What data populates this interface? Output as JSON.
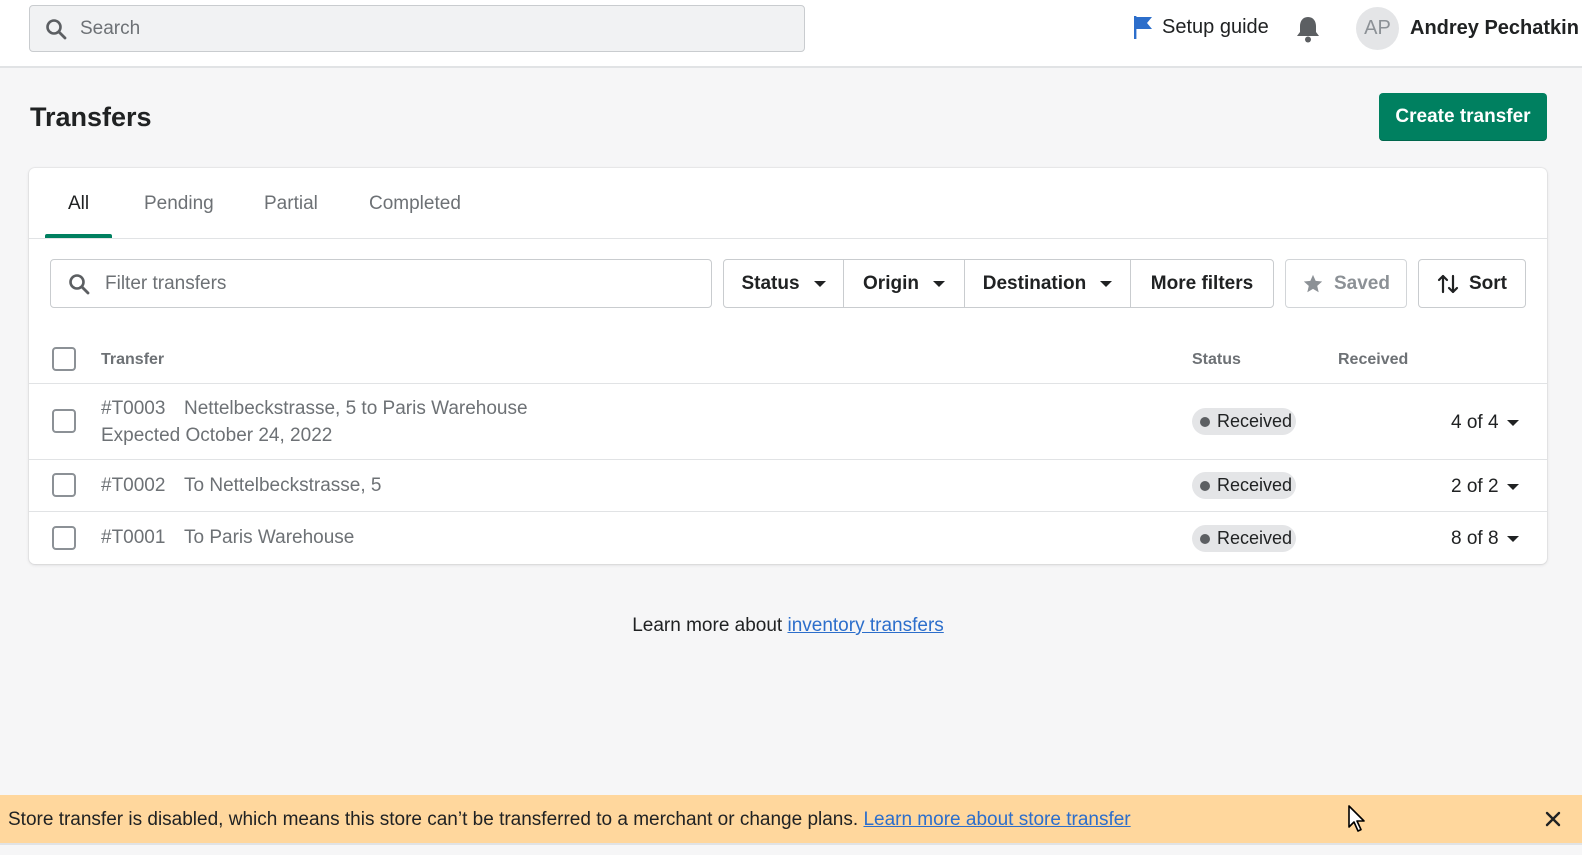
{
  "topbar": {
    "search_placeholder": "Search",
    "setup_guide": "Setup guide",
    "avatar_initials": "AP",
    "user_name": "Andrey Pechatkin"
  },
  "page": {
    "title": "Transfers",
    "create_button": "Create transfer"
  },
  "tabs": [
    {
      "label": "All",
      "active": true
    },
    {
      "label": "Pending"
    },
    {
      "label": "Partial"
    },
    {
      "label": "Completed"
    }
  ],
  "filters": {
    "search_placeholder": "Filter transfers",
    "status": "Status",
    "origin": "Origin",
    "destination": "Destination",
    "more": "More filters",
    "saved": "Saved",
    "sort": "Sort"
  },
  "table": {
    "columns": {
      "transfer": "Transfer",
      "status": "Status",
      "received": "Received"
    },
    "rows": [
      {
        "id": "#T0003",
        "description": "Nettelbeckstrasse, 5 to Paris Warehouse",
        "expected": "Expected October 24, 2022",
        "status": "Received",
        "received": "4 of 4"
      },
      {
        "id": "#T0002",
        "description": "To Nettelbeckstrasse, 5",
        "status": "Received",
        "received": "2 of 2"
      },
      {
        "id": "#T0001",
        "description": "To Paris Warehouse",
        "status": "Received",
        "received": "8 of 8"
      }
    ]
  },
  "footer": {
    "learn_prefix": "Learn more about ",
    "learn_link": "inventory transfers"
  },
  "banner": {
    "text": "Store transfer is disabled, which means this store can’t be transferred to a merchant or change plans. ",
    "link": "Learn more about store transfer"
  },
  "colors": {
    "primary": "#008060",
    "banner_bg": "#ffd79d",
    "link": "#2c6ecb",
    "flag": "#2c6ecb"
  }
}
